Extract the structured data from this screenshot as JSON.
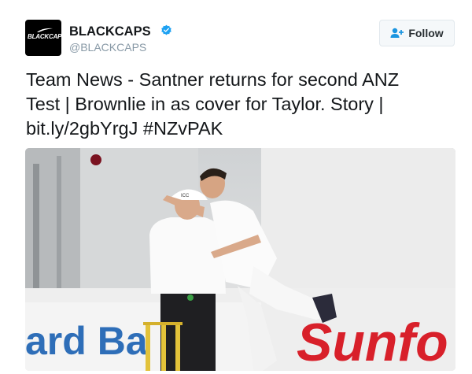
{
  "tweet": {
    "author": {
      "display_name": "BLACKCAPS",
      "handle": "@BLACKCAPS",
      "avatar_text": "BLACKCAPS",
      "verified_icon": "verified-badge-icon"
    },
    "follow_button": {
      "label": "Follow",
      "icon": "add-user-icon"
    },
    "text_lines": [
      "Team News - Santner returns for second ANZ",
      "Test | Brownlie in as cover for Taylor. Story |",
      "bit.ly/2gbYrgJ #NZvPAK"
    ],
    "media": {
      "banner_text_left": "ard Ba",
      "banner_text_right": "Sunfo",
      "umpire_cap_text": "ICC"
    }
  },
  "colors": {
    "verified": "#1da1f2",
    "text": "#14171a",
    "muted": "#8899a6",
    "link": "#1b95e0"
  }
}
